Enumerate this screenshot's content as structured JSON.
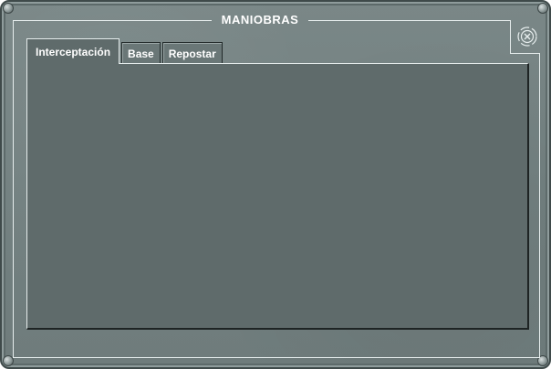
{
  "window": {
    "title": "MANIOBRAS"
  },
  "close_button": {
    "icon": "close-icon"
  },
  "tabs": [
    {
      "label": "Interceptación",
      "active": true
    },
    {
      "label": "Base",
      "active": false
    },
    {
      "label": "Repostar",
      "active": false
    }
  ],
  "colors": {
    "panel_background": "#5f6b6b",
    "window_background": "#737f7f",
    "frame_line": "#e6eded",
    "text": "#ffffff"
  }
}
